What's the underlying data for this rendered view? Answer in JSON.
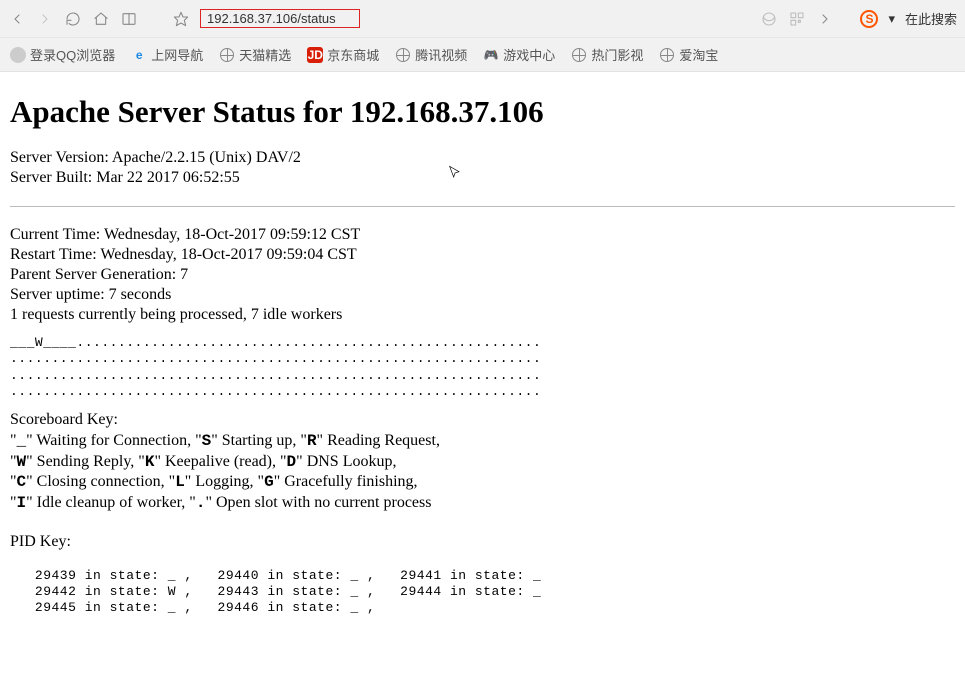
{
  "addressbar": {
    "url": "192.168.37.106/status",
    "search_hint": "在此搜索"
  },
  "bookmarks": [
    {
      "label": "登录QQ浏览器",
      "icon": "qq"
    },
    {
      "label": "上网导航",
      "icon": "e"
    },
    {
      "label": "天猫精选",
      "icon": "globe"
    },
    {
      "label": "京东商城",
      "icon": "jd"
    },
    {
      "label": "腾讯视频",
      "icon": "globe"
    },
    {
      "label": "游戏中心",
      "icon": "ctrl"
    },
    {
      "label": "热门影视",
      "icon": "globe"
    },
    {
      "label": "爱淘宝",
      "icon": "globe"
    }
  ],
  "page": {
    "title_prefix": "Apache Server Status for ",
    "title_host": "192.168.37.106",
    "server_version_label": "Server Version: ",
    "server_version_value": "Apache/2.2.15 (Unix) DAV/2",
    "server_built_label": "Server Built: ",
    "server_built_value": "Mar 22 2017 06:52:55",
    "current_time_label": "Current Time: ",
    "current_time_value": "Wednesday, 18-Oct-2017 09:59:12 CST",
    "restart_time_label": "Restart Time: ",
    "restart_time_value": "Wednesday, 18-Oct-2017 09:59:04 CST",
    "parent_gen_label": "Parent Server Generation: ",
    "parent_gen_value": "7",
    "uptime_label": "Server uptime: ",
    "uptime_value": " 7 seconds",
    "workers_line": "1 requests currently being processed, 7 idle workers",
    "scoreboard": "___W____........................................................\n................................................................\n................................................................\n................................................................",
    "scoreboard_key_heading": "Scoreboard Key:",
    "scoreboard_key_lines_html": [
      "\"<b>_</b>\" Waiting for Connection, \"<b>S</b>\" Starting up, \"<b>R</b>\" Reading Request,",
      "\"<b>W</b>\" Sending Reply, \"<b>K</b>\" Keepalive (read), \"<b>D</b>\" DNS Lookup,",
      "\"<b>C</b>\" Closing connection, \"<b>L</b>\" Logging, \"<b>G</b>\" Gracefully finishing,",
      "\"<b>I</b>\" Idle cleanup of worker, \"<b>.</b>\" Open slot with no current process"
    ],
    "pid_key_heading": "PID Key:",
    "pid_key_text": "   29439 in state: _ ,   29440 in state: _ ,   29441 in state: _\n   29442 in state: W ,   29443 in state: _ ,   29444 in state: _\n   29445 in state: _ ,   29446 in state: _ ,"
  }
}
